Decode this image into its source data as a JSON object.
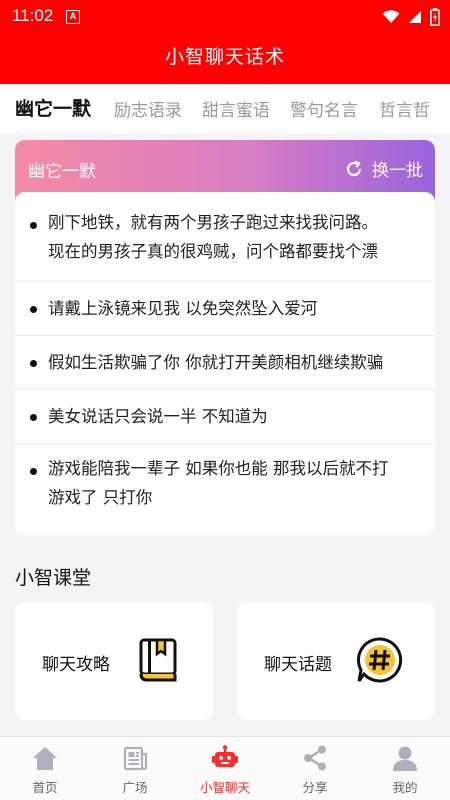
{
  "status_bar": {
    "time": "11:02",
    "badge": "A"
  },
  "app_bar": {
    "title": "小智聊天话术"
  },
  "tabs": [
    {
      "label": "幽它一默"
    },
    {
      "label": "励志语录"
    },
    {
      "label": "甜言蜜语"
    },
    {
      "label": "警句名言"
    },
    {
      "label": "哲言哲"
    }
  ],
  "card": {
    "title": "幽它一默",
    "refresh_label": "换一批",
    "quotes": [
      {
        "line1": "刚下地铁，就有两个男孩子跑过来找我问路。",
        "line2": "现在的男孩子真的很鸡贼，问个路都要找个漂"
      },
      {
        "line1": "请戴上泳镜来见我 以免突然坠入爱河"
      },
      {
        "line1": "假如生活欺骗了你 你就打开美颜相机继续欺骗"
      },
      {
        "line1": "美女说话只会说一半 不知道为"
      },
      {
        "line1": "游戏能陪我一辈子 如果你也能 那我以后就不打",
        "line2": "游戏了 只打你"
      }
    ]
  },
  "section": {
    "title": "小智课堂",
    "items": [
      {
        "label": "聊天攻略",
        "icon": "book-icon"
      },
      {
        "label": "聊天话题",
        "icon": "hashtag-bubble-icon"
      }
    ]
  },
  "bottom_nav": [
    {
      "label": "首页",
      "icon": "home-icon"
    },
    {
      "label": "广场",
      "icon": "newspaper-icon"
    },
    {
      "label": "小智聊天",
      "icon": "robot-icon"
    },
    {
      "label": "分享",
      "icon": "share-icon"
    },
    {
      "label": "我的",
      "icon": "user-icon"
    }
  ],
  "colors": {
    "primary": "#ff0000",
    "active_nav": "#ff2a2a",
    "gradient_start": "#f58aa4",
    "gradient_end": "#9a63dc",
    "icon_yellow": "#f7c531"
  }
}
